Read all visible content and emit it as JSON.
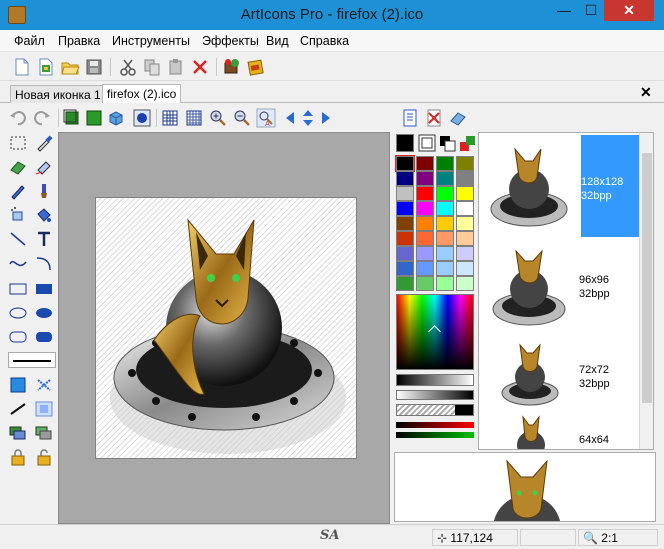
{
  "window": {
    "title": "ArtIcons Pro - firefox (2).ico",
    "controls": {
      "minimize": "—",
      "maximize": "☐",
      "close": "✕"
    }
  },
  "menu": {
    "items": [
      "Файл",
      "Правка",
      "Инструменты",
      "Эффекты",
      "Вид",
      "Справка"
    ]
  },
  "toolbar": {
    "icons": [
      "new-icon",
      "new-from-image-icon",
      "open-icon",
      "save-icon",
      "cut-icon",
      "copy-icon",
      "paste-icon",
      "delete-icon",
      "extract-icon",
      "library-icon"
    ]
  },
  "tabs": {
    "items": [
      {
        "label": "Новая иконка 1",
        "active": false
      },
      {
        "label": "firefox (2).ico",
        "active": true
      }
    ],
    "close": "✕"
  },
  "palette": {
    "colors": [
      "#000000",
      "#800000",
      "#008000",
      "#808000",
      "#000080",
      "#800080",
      "#008080",
      "#808080",
      "#c0c0c0",
      "#ff0000",
      "#00ff00",
      "#ffff00",
      "#0000ff",
      "#ff00ff",
      "#00ffff",
      "#ffffff",
      "#804000",
      "#ff8000",
      "#ffcc00",
      "#ffff99",
      "#cc3300",
      "#ff6633",
      "#ff9966",
      "#ffcc99",
      "#6666cc",
      "#9999ff",
      "#99ccff",
      "#ccccff",
      "#3366cc",
      "#6699ff",
      "#99ccff",
      "#cce6ff",
      "#339933",
      "#66cc66",
      "#99ff99",
      "#ccffcc"
    ]
  },
  "formats": {
    "items": [
      {
        "size": "128x128",
        "depth": "32bpp",
        "selected": true
      },
      {
        "size": "96x96",
        "depth": "32bpp",
        "selected": false
      },
      {
        "size": "72x72",
        "depth": "32bpp",
        "selected": false
      },
      {
        "size": "64x64",
        "depth": "",
        "selected": false
      }
    ]
  },
  "status": {
    "coords": "117,124",
    "zoom": "2:1",
    "watermark": "SA"
  }
}
